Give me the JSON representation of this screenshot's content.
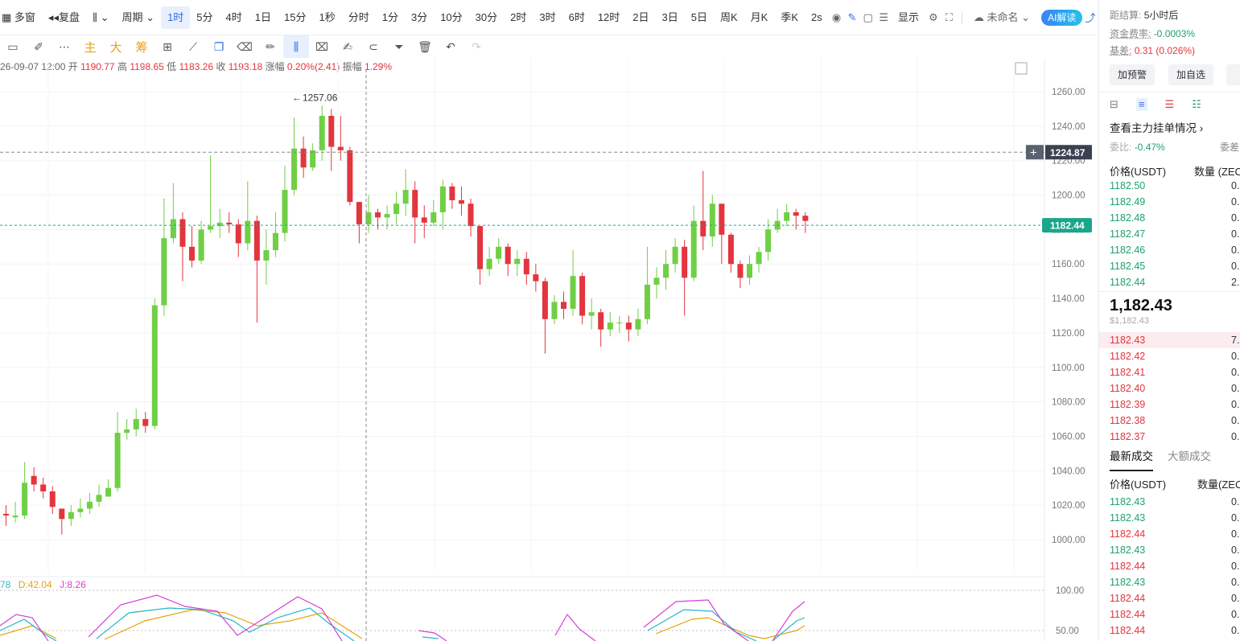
{
  "topbar": {
    "multi_window": "多窗",
    "replay": "复盘",
    "period_menu": "周期",
    "periods": [
      "1时",
      "5分",
      "4时",
      "1日",
      "15分",
      "1秒",
      "分时",
      "1分",
      "3分",
      "10分",
      "30分",
      "2时",
      "3时",
      "6时",
      "12时",
      "2日",
      "3日",
      "5日",
      "周K",
      "月K",
      "季K"
    ],
    "active_period": "1时",
    "interval": "2s",
    "display": "显示",
    "unnamed": "未命名",
    "ai": "AI解读"
  },
  "ohlc": {
    "time": "26-09-07 12:00",
    "open_label": "开",
    "open": "1190.77",
    "high_label": "高",
    "high": "1198.65",
    "low_label": "低",
    "low": "1183.26",
    "close_label": "收",
    "close": "1193.18",
    "change_label": "涨幅",
    "change": "0.20%(2.41)",
    "amp_label": "振幅",
    "amp": "1.29%"
  },
  "chart_data": {
    "type": "candlestick",
    "y_ticks": [
      "1260.00",
      "1240.00",
      "1220.00",
      "1200.00",
      "1180.00",
      "1160.00",
      "1140.00",
      "1120.00",
      "1100.00",
      "1080.00",
      "1060.00",
      "1040.00",
      "1020.00",
      "1000.00"
    ],
    "ylim": [
      994,
      1265
    ],
    "high_marker": "1257.06",
    "crosshair_price": "1224.87",
    "current_price": "1182.44",
    "up_color": "#6fcf45",
    "down_color": "#e3353d",
    "candles": [
      [
        1015,
        1014,
        1020,
        1008
      ],
      [
        1013,
        1014,
        1022,
        1010
      ],
      [
        1014,
        1033,
        1045,
        1012
      ],
      [
        1037,
        1032,
        1042,
        1028
      ],
      [
        1032,
        1028,
        1036,
        1024
      ],
      [
        1028,
        1019,
        1031,
        1015
      ],
      [
        1018,
        1012,
        1015,
        1003
      ],
      [
        1012,
        1016,
        1020,
        1008
      ],
      [
        1016,
        1018,
        1024,
        1013
      ],
      [
        1018,
        1022,
        1027,
        1015
      ],
      [
        1022,
        1026,
        1032,
        1019
      ],
      [
        1025,
        1030,
        1035,
        1025
      ],
      [
        1030,
        1062,
        1074,
        1028
      ],
      [
        1062,
        1064,
        1070,
        1058
      ],
      [
        1064,
        1070,
        1076,
        1060
      ],
      [
        1070,
        1066,
        1074,
        1062
      ],
      [
        1066,
        1136,
        1140,
        1064
      ],
      [
        1136,
        1175,
        1198,
        1130
      ],
      [
        1175,
        1186,
        1207,
        1172
      ],
      [
        1186,
        1170,
        1190,
        1150
      ],
      [
        1170,
        1162,
        1182,
        1158
      ],
      [
        1162,
        1180,
        1185,
        1160
      ],
      [
        1180,
        1182,
        1223,
        1178
      ],
      [
        1182,
        1184,
        1192,
        1175
      ],
      [
        1184,
        1183,
        1190,
        1178
      ],
      [
        1183,
        1172,
        1186,
        1164
      ],
      [
        1172,
        1185,
        1208,
        1168
      ],
      [
        1185,
        1162,
        1188,
        1126
      ],
      [
        1162,
        1168,
        1180,
        1148
      ],
      [
        1168,
        1178,
        1190,
        1164
      ],
      [
        1178,
        1203,
        1217,
        1173
      ],
      [
        1203,
        1227,
        1245,
        1200
      ],
      [
        1227,
        1216,
        1234,
        1210
      ],
      [
        1216,
        1226,
        1230,
        1214
      ],
      [
        1226,
        1246,
        1252,
        1220
      ],
      [
        1246,
        1228,
        1250,
        1214
      ],
      [
        1228,
        1226,
        1246,
        1220
      ],
      [
        1226,
        1196,
        1228,
        1194
      ],
      [
        1196,
        1183,
        1196,
        1172
      ],
      [
        1183,
        1190,
        1200,
        1178
      ],
      [
        1190,
        1187,
        1192,
        1180
      ],
      [
        1187,
        1189,
        1194,
        1180
      ],
      [
        1189,
        1195,
        1202,
        1183
      ],
      [
        1195,
        1203,
        1215,
        1188
      ],
      [
        1203,
        1187,
        1208,
        1172
      ],
      [
        1187,
        1184,
        1194,
        1175
      ],
      [
        1184,
        1190,
        1197,
        1182
      ],
      [
        1190,
        1205,
        1209,
        1180
      ],
      [
        1205,
        1197,
        1207,
        1192
      ],
      [
        1197,
        1195,
        1205,
        1188
      ],
      [
        1195,
        1182,
        1198,
        1176
      ],
      [
        1182,
        1157,
        1180,
        1148
      ],
      [
        1157,
        1163,
        1170,
        1153
      ],
      [
        1163,
        1170,
        1175,
        1160
      ],
      [
        1170,
        1160,
        1172,
        1153
      ],
      [
        1160,
        1163,
        1168,
        1153
      ],
      [
        1163,
        1154,
        1167,
        1148
      ],
      [
        1154,
        1150,
        1160,
        1144
      ],
      [
        1150,
        1128,
        1152,
        1108
      ],
      [
        1128,
        1138,
        1142,
        1125
      ],
      [
        1138,
        1134,
        1144,
        1128
      ],
      [
        1134,
        1153,
        1168,
        1130
      ],
      [
        1153,
        1130,
        1155,
        1125
      ],
      [
        1130,
        1132,
        1140,
        1122
      ],
      [
        1132,
        1122,
        1134,
        1112
      ],
      [
        1122,
        1126,
        1132,
        1118
      ],
      [
        1126,
        1126,
        1130,
        1120
      ],
      [
        1126,
        1122,
        1130,
        1115
      ],
      [
        1122,
        1128,
        1134,
        1118
      ],
      [
        1128,
        1148,
        1170,
        1125
      ],
      [
        1148,
        1152,
        1158,
        1140
      ],
      [
        1152,
        1160,
        1168,
        1145
      ],
      [
        1160,
        1170,
        1175,
        1155
      ],
      [
        1170,
        1152,
        1174,
        1130
      ],
      [
        1152,
        1185,
        1194,
        1150
      ],
      [
        1185,
        1176,
        1214,
        1168
      ],
      [
        1176,
        1195,
        1200,
        1170
      ],
      [
        1195,
        1177,
        1190,
        1160
      ],
      [
        1177,
        1160,
        1178,
        1155
      ],
      [
        1160,
        1152,
        1162,
        1146
      ],
      [
        1152,
        1160,
        1165,
        1148
      ],
      [
        1160,
        1167,
        1170,
        1155
      ],
      [
        1167,
        1180,
        1186,
        1162
      ],
      [
        1180,
        1185,
        1192,
        1178
      ],
      [
        1185,
        1190,
        1195,
        1182
      ],
      [
        1190,
        1188,
        1192,
        1180
      ],
      [
        1188,
        1185,
        1190,
        1178
      ]
    ],
    "kdj": {
      "legend": [
        {
          "label": "78",
          "color": "#27b6c9"
        },
        {
          "label": "D:42.04",
          "color": "#e6a30d"
        },
        {
          "label": "J:8.26",
          "color": "#d63fd6"
        }
      ],
      "ticks": [
        "100.00",
        "50.00"
      ]
    }
  },
  "panel": {
    "settle_label": "距结算:",
    "settle_value": "5小时后",
    "funding_label": "资金费率:",
    "funding_value": "-0.0003%",
    "basis_label": "基差:",
    "basis_value": "0.31 (0.026%)",
    "btn_alert": "加预警",
    "btn_watch": "加自选",
    "depth_link": "查看主力挂单情况",
    "weibi_label": "委比:",
    "weibi_value": "-0.47%",
    "weicha_label": "委差",
    "col_price": "价格(USDT)",
    "col_qty": "数量 (ZEC",
    "asks": [
      [
        "1182.50",
        "0."
      ],
      [
        "1182.49",
        "0."
      ],
      [
        "1182.48",
        "0."
      ],
      [
        "1182.47",
        "0."
      ],
      [
        "1182.46",
        "0."
      ],
      [
        "1182.45",
        "0."
      ],
      [
        "1182.44",
        "2."
      ]
    ],
    "last_price": "1,182.43",
    "last_usd": "$1,182.43",
    "bids": [
      [
        "1182.43",
        "7."
      ],
      [
        "1182.42",
        "0."
      ],
      [
        "1182.41",
        "0."
      ],
      [
        "1182.40",
        "0."
      ],
      [
        "1182.39",
        "0."
      ],
      [
        "1182.38",
        "0."
      ],
      [
        "1182.37",
        "0."
      ]
    ],
    "tab_latest": "最新成交",
    "tab_large": "大额成交",
    "trade_col_price": "价格(USDT)",
    "trade_col_qty": "数量(ZEC",
    "trades": [
      [
        "1182.43",
        "up"
      ],
      [
        "1182.43",
        "up"
      ],
      [
        "1182.44",
        "dn"
      ],
      [
        "1182.43",
        "up"
      ],
      [
        "1182.44",
        "dn"
      ],
      [
        "1182.43",
        "up"
      ],
      [
        "1182.44",
        "dn"
      ],
      [
        "1182.44",
        "dn"
      ],
      [
        "1182.44",
        "dn"
      ]
    ],
    "trade_qty": "0."
  }
}
